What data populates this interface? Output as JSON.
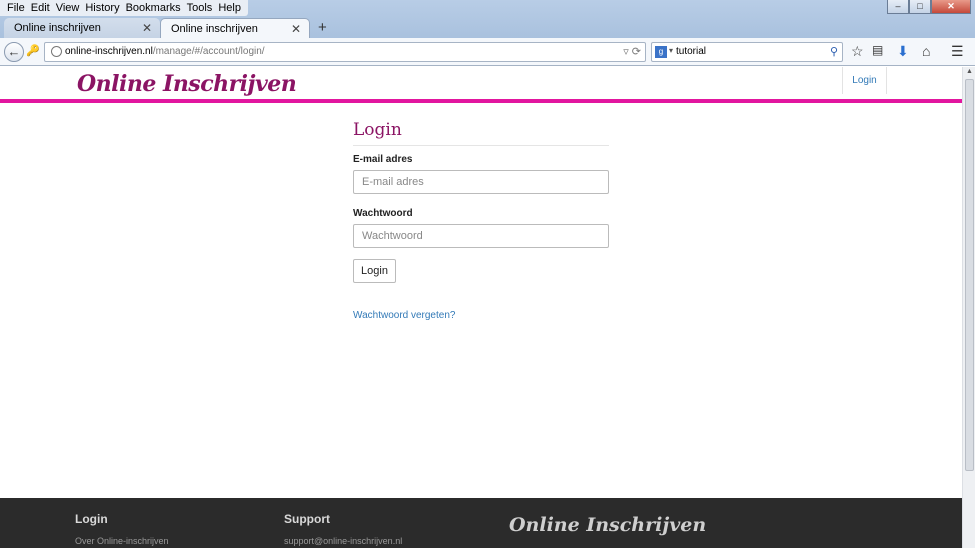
{
  "browser": {
    "menu": [
      "File",
      "Edit",
      "View",
      "History",
      "Bookmarks",
      "Tools",
      "Help"
    ],
    "tabs": [
      {
        "title": "Online inschrijven"
      },
      {
        "title": "Online inschrijven"
      }
    ],
    "url_host": "online-inschrijven.nl",
    "url_path": "/manage/#/account/login/",
    "search_text": "tutorial"
  },
  "site": {
    "brand": "Online Inschrijven",
    "nav_login": "Login",
    "accent_color": "#e2169f",
    "brand_color": "#8b1464"
  },
  "login": {
    "title": "Login",
    "email_label": "E-mail adres",
    "email_placeholder": "E-mail adres",
    "password_label": "Wachtwoord",
    "password_placeholder": "Wachtwoord",
    "submit_label": "Login",
    "forgot_link": "Wachtwoord vergeten?"
  },
  "footer": {
    "col1_title": "Login",
    "col1_link": "Over Online-inschrijven",
    "col2_title": "Support",
    "col2_link": "support@online-inschrijven.nl",
    "brand": "Online Inschrijven"
  }
}
